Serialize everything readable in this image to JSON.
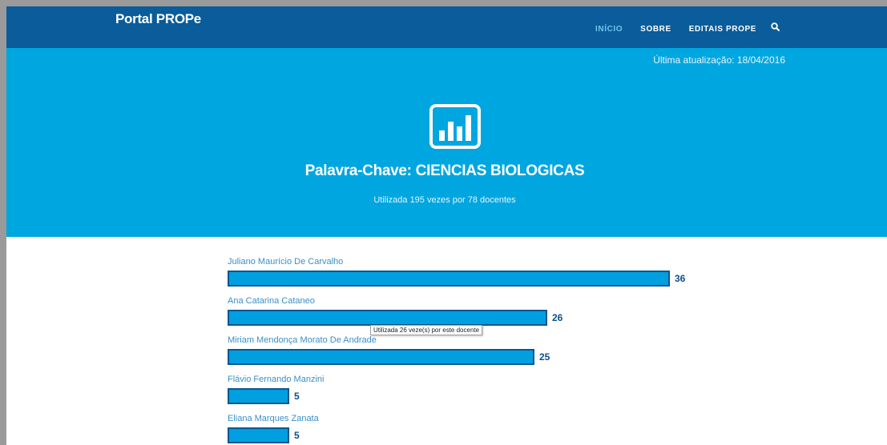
{
  "nav": {
    "brand": "Portal PROPe",
    "items": [
      {
        "label": "INÍCIO",
        "active": true
      },
      {
        "label": "SOBRE",
        "active": false
      },
      {
        "label": "EDITAIS PROPE",
        "active": false
      }
    ],
    "search_icon": "search-icon"
  },
  "hero": {
    "updated": "Última atualização: 18/04/2016",
    "icon": "bar-chart-icon",
    "title": "Palavra-Chave: CIENCIAS BIOLOGICAS",
    "subtitle": "Utilizada 195 vezes por 78 docentes"
  },
  "chart_data": {
    "type": "bar",
    "orientation": "horizontal",
    "categories": [
      "Juliano Maurício De Carvalho",
      "Ana Catarina Cataneo",
      "Miriam Mendonça Morato De Andrade",
      "Flávio Fernando Manzini",
      "Eliana Marques Zanata"
    ],
    "values": [
      36,
      26,
      25,
      5,
      5
    ],
    "xlim": [
      0,
      36
    ]
  },
  "tooltip": "Utilizada 26 veze(s) por este docente",
  "colors": {
    "navbar": "#0a5c9a",
    "hero": "#00a6e0",
    "bar_fill": "#009fe0",
    "bar_border": "#0c5690",
    "value_text": "#0c4f8a",
    "name_text": "#3a8fc7",
    "nav_active": "#6ec6f0"
  }
}
